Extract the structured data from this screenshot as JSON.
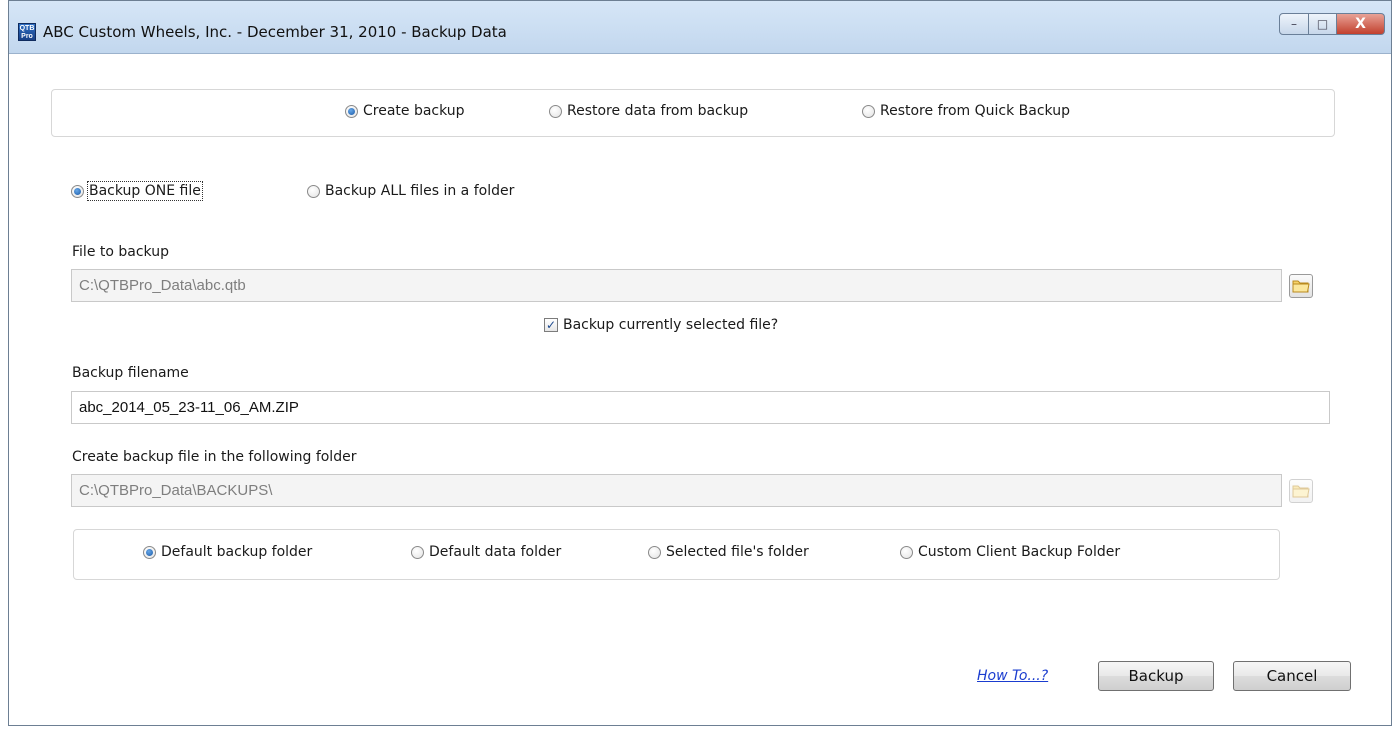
{
  "window": {
    "title": "ABC Custom Wheels, Inc. - December 31, 2010 - Backup Data",
    "app_icon_text_top": "QTB",
    "app_icon_text_bottom": "Pro",
    "controls": {
      "minimize": "–",
      "maximize": "□",
      "close": "X"
    }
  },
  "mode_group": {
    "options": [
      {
        "label": "Create backup",
        "checked": true
      },
      {
        "label": "Restore data from backup",
        "checked": false
      },
      {
        "label": "Restore from Quick Backup",
        "checked": false
      }
    ]
  },
  "scope": {
    "options": [
      {
        "label": "Backup ONE file",
        "checked": true
      },
      {
        "label": "Backup ALL files in a folder",
        "checked": false
      }
    ]
  },
  "file_to_backup": {
    "label": "File to backup",
    "value": "C:\\QTBPro_Data\\abc.qtb"
  },
  "selected_file_checkbox": {
    "label": "Backup currently selected file?",
    "checked": true
  },
  "backup_filename": {
    "label": "Backup filename",
    "value": "abc_2014_05_23-11_06_AM.ZIP"
  },
  "backup_folder": {
    "label": "Create backup file in the following folder",
    "value": "C:\\QTBPro_Data\\BACKUPS\\"
  },
  "folder_group": {
    "options": [
      {
        "label": "Default backup folder",
        "checked": true
      },
      {
        "label": "Default data folder",
        "checked": false
      },
      {
        "label": "Selected file's folder",
        "checked": false
      },
      {
        "label": "Custom Client Backup Folder",
        "checked": false
      }
    ]
  },
  "footer": {
    "help_link": "How To...?",
    "backup_button": "Backup",
    "cancel_button": "Cancel"
  },
  "colors": {
    "title_bar": "#c8dbf0",
    "radio_dot": "#1c5aa6",
    "link": "#1a3ccf",
    "close_button": "#c2402d"
  }
}
